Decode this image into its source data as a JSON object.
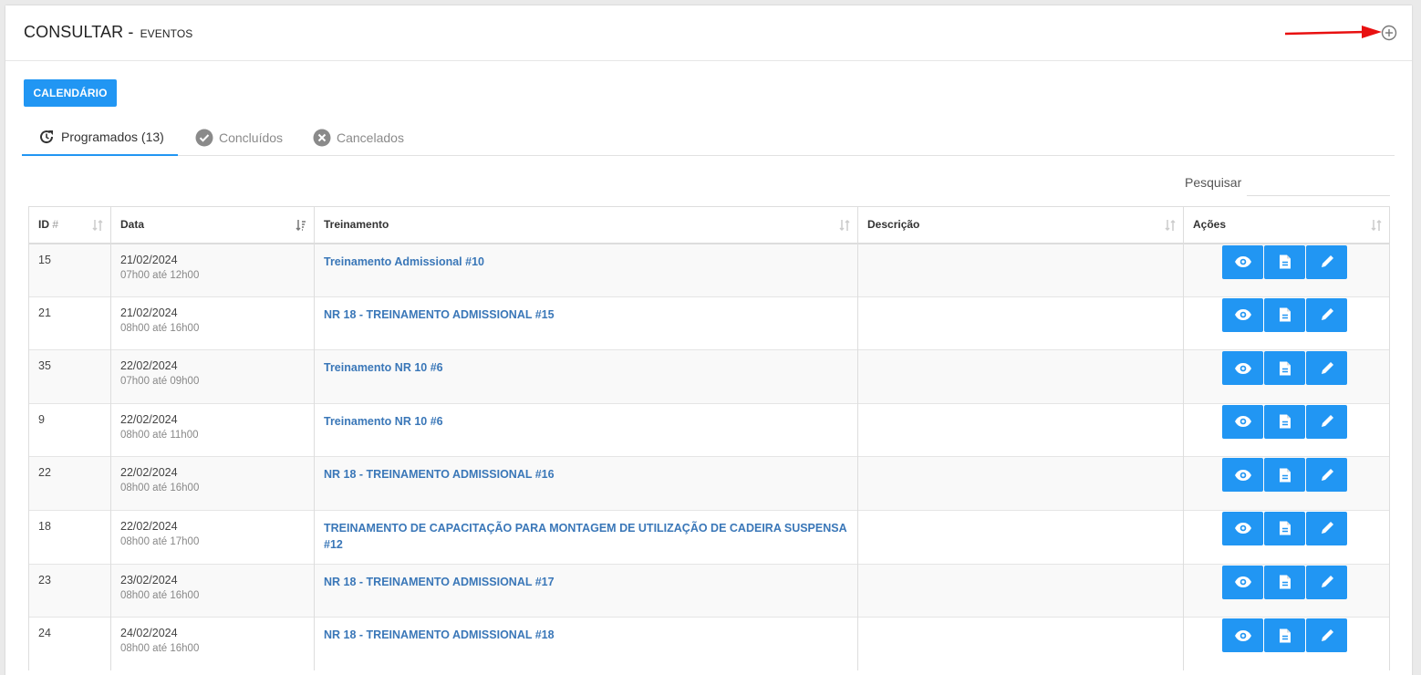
{
  "header": {
    "title": "CONSULTAR -",
    "subtitle": "EVENTOS"
  },
  "toolbar": {
    "calendar_label": "CALENDÁRIO"
  },
  "tabs": [
    {
      "label": "Programados (13)",
      "icon": "refresh-icon",
      "active": true
    },
    {
      "label": "Concluídos",
      "icon": "check-circle-icon",
      "active": false
    },
    {
      "label": "Cancelados",
      "icon": "cancel-circle-icon",
      "active": false
    }
  ],
  "search": {
    "label": "Pesquisar",
    "value": "",
    "placeholder": ""
  },
  "table": {
    "columns": [
      "ID",
      "#",
      "Data",
      "Treinamento",
      "Descrição",
      "Ações"
    ],
    "rows": [
      {
        "id": "15",
        "date": "21/02/2024",
        "time": "07h00 até 12h00",
        "training": "Treinamento Admissional #10",
        "description": ""
      },
      {
        "id": "21",
        "date": "21/02/2024",
        "time": "08h00 até 16h00",
        "training": "NR 18 - TREINAMENTO ADMISSIONAL #15",
        "description": ""
      },
      {
        "id": "35",
        "date": "22/02/2024",
        "time": "07h00 até 09h00",
        "training": "Treinamento NR 10 #6",
        "description": ""
      },
      {
        "id": "9",
        "date": "22/02/2024",
        "time": "08h00 até 11h00",
        "training": "Treinamento NR 10 #6",
        "description": ""
      },
      {
        "id": "22",
        "date": "22/02/2024",
        "time": "08h00 até 16h00",
        "training": "NR 18 - TREINAMENTO ADMISSIONAL #16",
        "description": ""
      },
      {
        "id": "18",
        "date": "22/02/2024",
        "time": "08h00 até 17h00",
        "training": "TREINAMENTO DE CAPACITAÇÃO PARA MONTAGEM DE UTILIZAÇÃO DE CADEIRA SUSPENSA #12",
        "description": ""
      },
      {
        "id": "23",
        "date": "23/02/2024",
        "time": "08h00 até 16h00",
        "training": "NR 18 - TREINAMENTO ADMISSIONAL #17",
        "description": ""
      },
      {
        "id": "24",
        "date": "24/02/2024",
        "time": "08h00 até 16h00",
        "training": "NR 18 - TREINAMENTO ADMISSIONAL #18",
        "description": ""
      }
    ]
  },
  "colors": {
    "primary": "#2196f3",
    "link": "#3a77b8",
    "annotation_arrow": "#e81010"
  }
}
